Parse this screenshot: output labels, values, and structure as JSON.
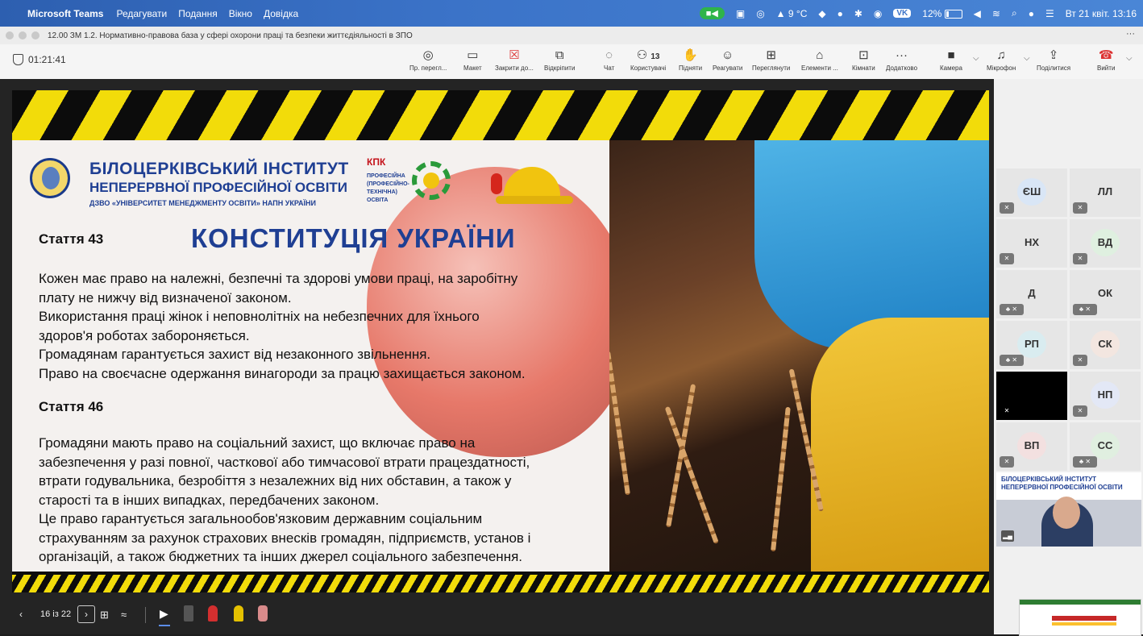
{
  "menubar": {
    "app": "Microsoft Teams",
    "items": [
      "Редагувати",
      "Подання",
      "Вікно",
      "Довідка"
    ],
    "weather": "▲ 9 °C",
    "vpn": "VK",
    "battery": "12%",
    "datetime": "Вт 21 квіт. 13:16"
  },
  "window": {
    "title": "12.00 ЗМ 1.2. Нормативно-правова база у сфері охорони праці та безпеки життєдіяльності в ЗПО"
  },
  "meeting": {
    "timer": "01:21:41",
    "participants_count": "13",
    "buttons": {
      "preview": "Пр. перегл...",
      "layout": "Макет",
      "close": "Закрити до...",
      "unpin": "Відкріпити",
      "chat": "Чат",
      "people": "Користувачі",
      "raise": "Підняти",
      "react": "Реагувати",
      "view": "Переглянути",
      "elements": "Елементи ...",
      "rooms": "Кімнати",
      "more": "Додатково",
      "camera": "Камера",
      "mic": "Мікрофон",
      "share": "Поділитися",
      "leave": "Вийти"
    }
  },
  "slide": {
    "institute_line1": "БІЛОЦЕРКІВСЬКИЙ ІНСТИТУТ",
    "institute_line2": "НЕПЕРЕРВНОЇ ПРОФЕСІЙНОЇ ОСВІТИ",
    "institute_line3": "ДЗВО «УНІВЕРСИТЕТ МЕНЕДЖМЕНТУ ОСВІТИ» НАПН УКРАЇНИ",
    "kpk_title": "КПК",
    "kpk_sub": "ПРОФЕСІЙНА (ПРОФЕСІЙНО-ТЕХНІЧНА) ОСВІТА",
    "article43": "Стаття 43",
    "heading": "КОНСТИТУЦІЯ УКРАЇНИ",
    "text43": [
      "Кожен має право на належні, безпечні та здорові умови праці, на заробітну",
      "плату не нижчу від визначеної законом.",
      "Використання праці жінок і неповнолітніх на небезпечних для їхнього",
      "здоров'я роботах забороняється.",
      "Громадянам гарантується захист від незаконного звільнення.",
      "Право на своєчасне одержання винагороди за працю захищається законом."
    ],
    "article46": "Стаття 46",
    "text46": [
      "Громадяни мають право на соціальний захист, що включає право на",
      "забезпечення у разі повної, часткової або тимчасової втрати працездатності,",
      "втрати годувальника, безробіття з незалежних від них обставин, а також у",
      "старості та в інших випадках, передбачених законом.",
      "Це право гарантується загальнообов'язковим державним соціальним",
      "страхуванням за рахунок страхових внесків громадян, підприємств, установ і",
      "організацій, а також бюджетних та інших джерел соціального забезпечення."
    ]
  },
  "slide_nav": {
    "counter": "16 із 22"
  },
  "participants": [
    {
      "initials": "ЄШ",
      "color": "#d9e6f6"
    },
    {
      "initials": "ЛЛ",
      "color": "#e6e6e6"
    },
    {
      "initials": "НХ",
      "color": "#e6e6e6"
    },
    {
      "initials": "ВД",
      "color": "#dff0e0"
    },
    {
      "initials": "Д",
      "color": "#e6e6e6"
    },
    {
      "initials": "ОК",
      "color": "#e6e6e6"
    },
    {
      "initials": "РП",
      "color": "#d9ecf0"
    },
    {
      "initials": "СК",
      "color": "#f3e6e0"
    },
    {
      "initials": "",
      "color": "#000000"
    },
    {
      "initials": "НП",
      "color": "#e3e8f6"
    },
    {
      "initials": "ВП",
      "color": "#f3e0e0"
    },
    {
      "initials": "СС",
      "color": "#e0efe0"
    }
  ],
  "selfview_banner": "БІЛОЦЕРКІВСЬКИЙ ІНСТИТУТ НЕПЕРЕРВНОЇ ПРОФЕСІЙНОЇ ОСВІТИ"
}
